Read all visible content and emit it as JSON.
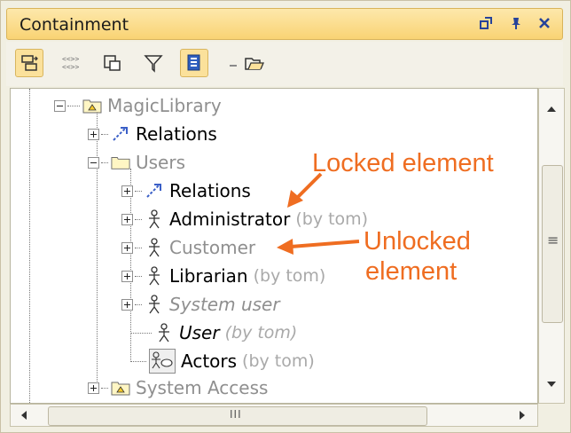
{
  "window": {
    "title": "Containment",
    "buttons": {
      "restore": "↗",
      "pin": "↕",
      "close": "✕"
    }
  },
  "toolbar": {
    "items": [
      {
        "name": "sync-icon",
        "active": true
      },
      {
        "name": "compartments-icon",
        "active": false
      },
      {
        "name": "packages-icon",
        "active": false
      },
      {
        "name": "filter-icon",
        "active": false
      },
      {
        "name": "show-icon",
        "active": true
      },
      {
        "name": "open-icon",
        "active": false
      }
    ]
  },
  "tree": {
    "nodes": [
      {
        "label": "MagicLibrary",
        "tag": "",
        "icon": "package-icon"
      },
      {
        "label": "Relations",
        "tag": "",
        "icon": "relations-icon"
      },
      {
        "label": "Users",
        "tag": "",
        "icon": "folder-icon"
      },
      {
        "label": "Relations",
        "tag": "",
        "icon": "relations-icon"
      },
      {
        "label": "Administrator",
        "tag": "(by tom)",
        "icon": "actor-icon"
      },
      {
        "label": "Customer",
        "tag": "",
        "icon": "actor-icon"
      },
      {
        "label": "Librarian",
        "tag": "(by tom)",
        "icon": "actor-icon"
      },
      {
        "label": "System user",
        "tag": "",
        "icon": "actor-icon"
      },
      {
        "label": "User",
        "tag": "(by tom)",
        "icon": "actor-icon"
      },
      {
        "label": "Actors",
        "tag": "(by tom)",
        "icon": "diagram-icon"
      },
      {
        "label": "System Access",
        "tag": "",
        "icon": "package-icon"
      }
    ]
  },
  "annotations": {
    "locked": "Locked element",
    "unlocked_line1": "Unlocked",
    "unlocked_line2": "element",
    "color": "#ef6d21"
  },
  "scrollbar": {
    "grip": "III",
    "vgrip": "≡"
  }
}
